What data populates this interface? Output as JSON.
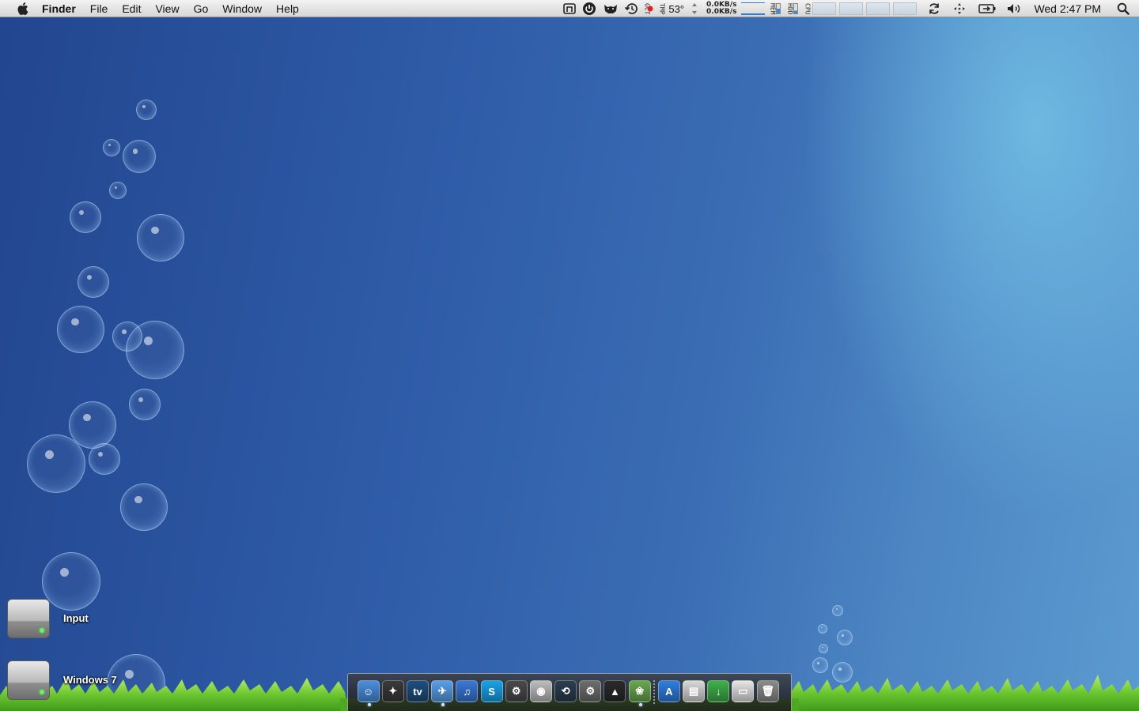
{
  "menubar": {
    "app_name": "Finder",
    "menus": [
      "File",
      "Edit",
      "View",
      "Go",
      "Window",
      "Help"
    ],
    "status": {
      "temperature": "53°",
      "temp_label_left": "GCT",
      "temp_label_right": "TMP",
      "net_up": "0.0KB/s",
      "net_down": "0.0KB/s",
      "mem_label": "MEM",
      "hdd_label": "HDD",
      "cpu_label": "CPU",
      "clock": "Wed 2:47 PM"
    },
    "icons": [
      "ilife-menu-icon",
      "power-icon",
      "cat-icon",
      "time-machine-icon",
      "sync-icon",
      "move-icon",
      "battery-icon",
      "volume-icon",
      "spotlight-icon"
    ]
  },
  "desktop": {
    "drives": [
      {
        "label": "Input"
      },
      {
        "label": "Windows 7"
      }
    ]
  },
  "dock": {
    "apps": [
      {
        "name": "Finder",
        "icon": "finder-icon",
        "color": "#4a8fe0",
        "glyph": "☺",
        "running": true
      },
      {
        "name": "Dashboard",
        "icon": "dashboard-icon",
        "color": "#3a3a3a",
        "glyph": "✦",
        "running": false
      },
      {
        "name": "TV",
        "icon": "tv-icon",
        "color": "#1f4f7f",
        "glyph": "tv",
        "running": false
      },
      {
        "name": "Safari",
        "icon": "safari-icon",
        "color": "#5aa0e8",
        "glyph": "✈",
        "running": true
      },
      {
        "name": "iTunes",
        "icon": "itunes-icon",
        "color": "#3a78d8",
        "glyph": "♫",
        "running": false
      },
      {
        "name": "Skype",
        "icon": "skype-icon",
        "color": "#1aa3e8",
        "glyph": "S",
        "running": false
      },
      {
        "name": "Steam",
        "icon": "steam-icon",
        "color": "#4a4a4a",
        "glyph": "⚙",
        "running": false
      },
      {
        "name": "DVD Player",
        "icon": "dvd-icon",
        "color": "#bdbdbd",
        "glyph": "◉",
        "running": false
      },
      {
        "name": "Time Machine",
        "icon": "time-machine-dock-icon",
        "color": "#2c3e50",
        "glyph": "⟲",
        "running": false
      },
      {
        "name": "System Preferences",
        "icon": "system-preferences-icon",
        "color": "#6e6e6e",
        "glyph": "⚙",
        "running": false
      },
      {
        "name": "Alfred",
        "icon": "hat-icon",
        "color": "#2a2a2a",
        "glyph": "▲",
        "running": false
      },
      {
        "name": "Stickies Game",
        "icon": "game-icon",
        "color": "#6aa84f",
        "glyph": "❀",
        "running": true
      },
      {
        "name": "App Store",
        "icon": "app-store-icon",
        "color": "#2f7fe0",
        "glyph": "A",
        "running": false
      },
      {
        "name": "Documents",
        "icon": "documents-icon",
        "color": "#d9d9d9",
        "glyph": "▤",
        "running": false
      },
      {
        "name": "Downloads",
        "icon": "downloads-icon",
        "color": "#3fb04a",
        "glyph": "↓",
        "running": false
      },
      {
        "name": "Mail Stack",
        "icon": "stack-icon",
        "color": "#e6e6e6",
        "glyph": "▭",
        "running": false
      },
      {
        "name": "Trash",
        "icon": "trash-icon",
        "color": "#8c8c8c",
        "glyph": "🗑",
        "running": false
      }
    ]
  }
}
